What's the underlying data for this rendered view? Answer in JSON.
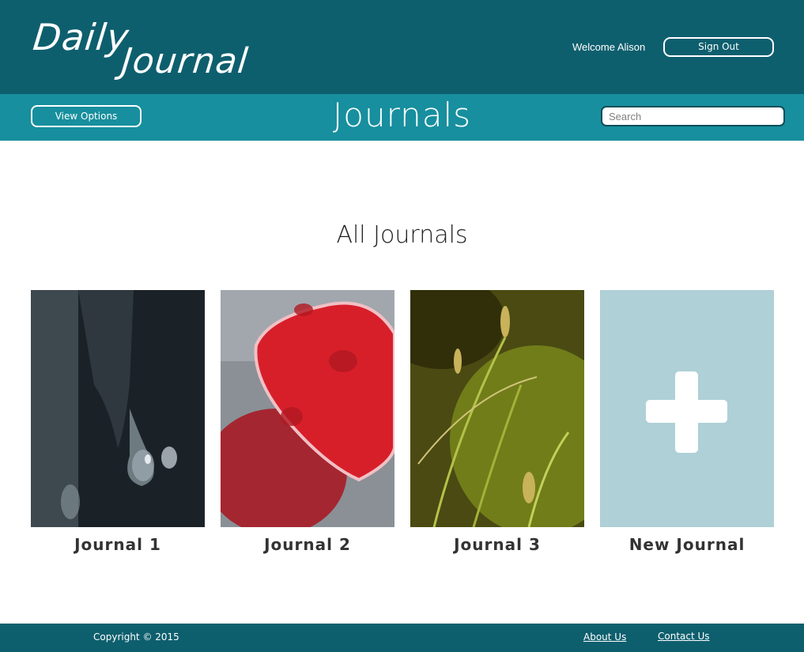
{
  "header": {
    "logo_line1": "Daily",
    "logo_line2": "Journal",
    "welcome_text": "Welcome Alison",
    "sign_out_label": "Sign Out"
  },
  "subbar": {
    "view_options_label": "View Options",
    "title": "Journals",
    "search_placeholder": "Search"
  },
  "main": {
    "section_title": "All Journals",
    "journals": [
      {
        "label": "Journal 1",
        "image": "water-drop-photo"
      },
      {
        "label": "Journal 2",
        "image": "red-heart-photo"
      },
      {
        "label": "Journal 3",
        "image": "grass-photo"
      },
      {
        "label": "New Journal",
        "image": "plus-icon"
      }
    ]
  },
  "footer": {
    "copyright": "Copyright © 2015",
    "about_label": "About Us",
    "contact_label": "Contact Us"
  },
  "colors": {
    "header_bg": "#0e5f6e",
    "subbar_bg": "#178f9e",
    "new_journal_bg": "#aed0d6",
    "footer_bg": "#0e5f6e"
  }
}
